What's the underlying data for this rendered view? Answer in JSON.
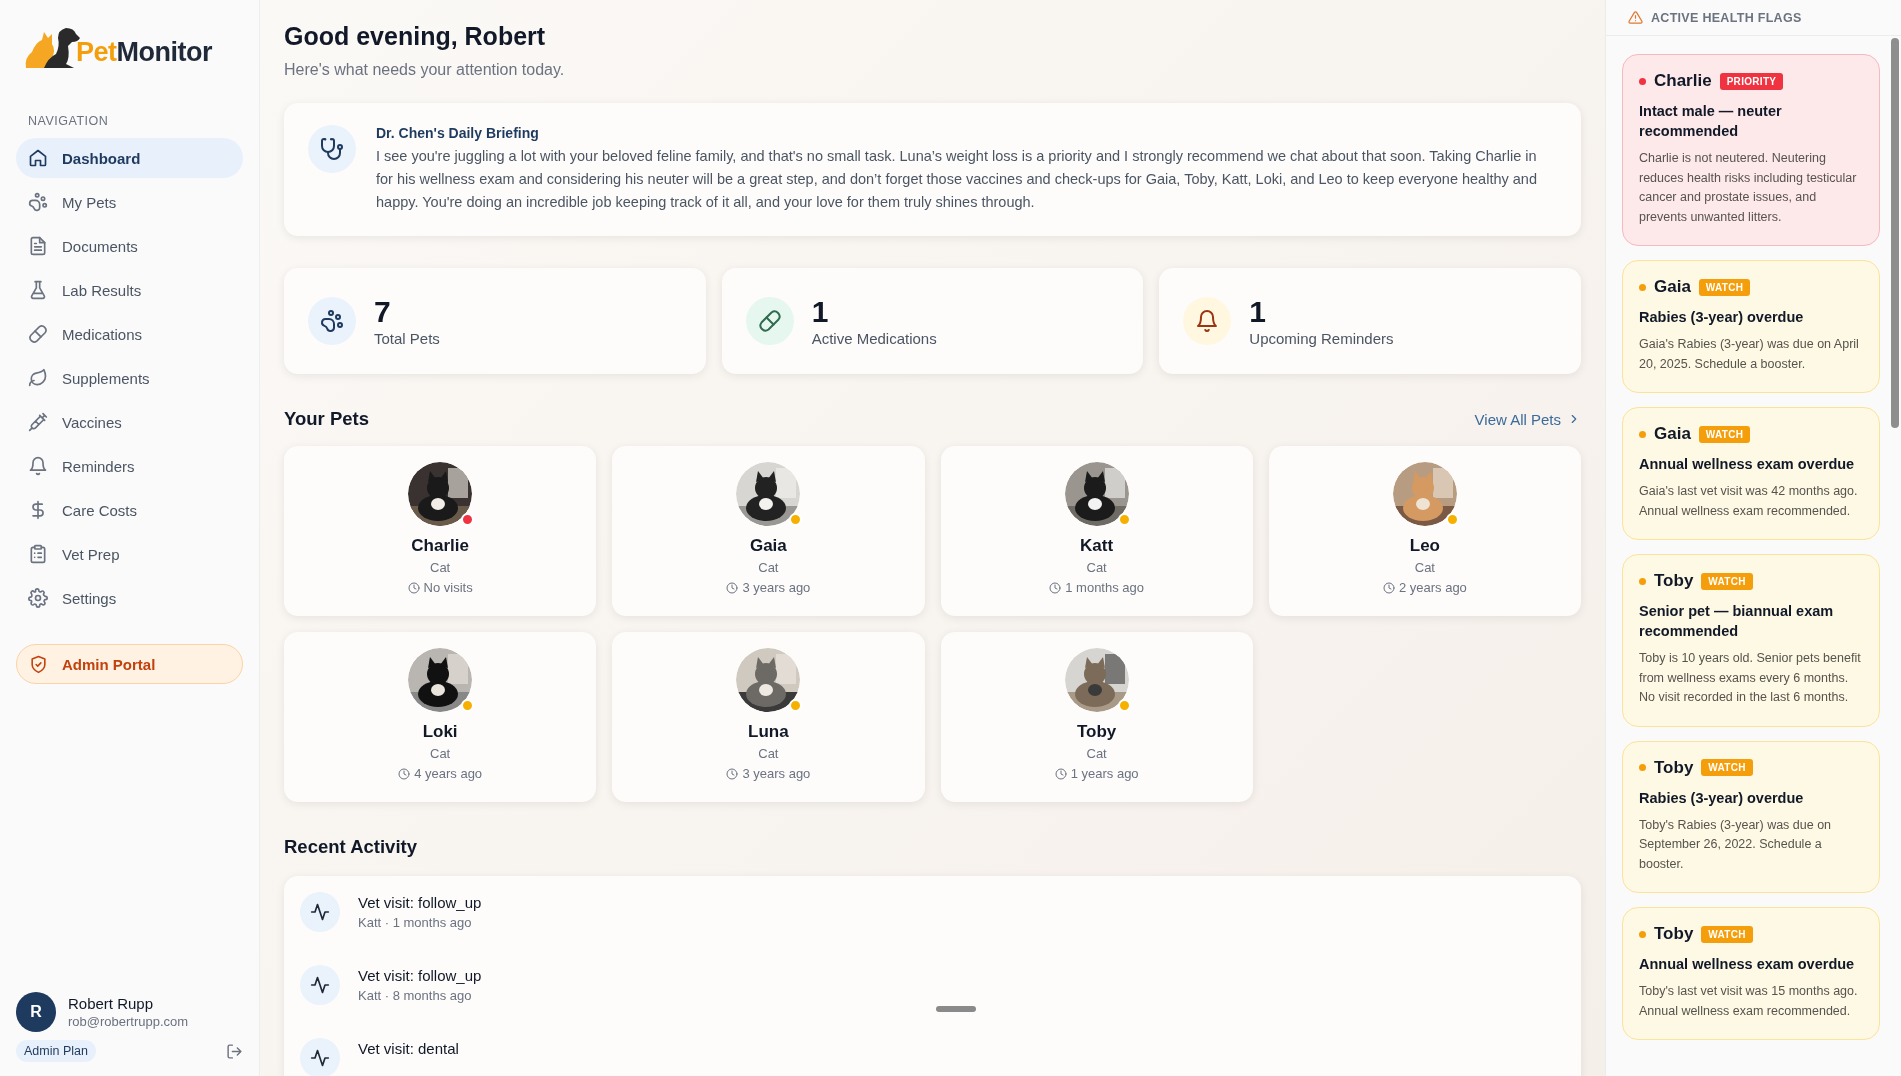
{
  "sidebar": {
    "logo": {
      "text_1": "Pet",
      "text_2": "Monitor"
    },
    "section_label": "NAVIGATION",
    "items": [
      {
        "label": "Dashboard",
        "selected": true
      },
      {
        "label": "My Pets",
        "selected": false
      },
      {
        "label": "Documents",
        "selected": false
      },
      {
        "label": "Lab Results",
        "selected": false
      },
      {
        "label": "Medications",
        "selected": false
      },
      {
        "label": "Supplements",
        "selected": false
      },
      {
        "label": "Vaccines",
        "selected": false
      },
      {
        "label": "Reminders",
        "selected": false
      },
      {
        "label": "Care Costs",
        "selected": false
      },
      {
        "label": "Vet Prep",
        "selected": false
      },
      {
        "label": "Settings",
        "selected": false
      }
    ],
    "admin_button": "Admin Portal",
    "user": {
      "initial": "R",
      "name": "Robert Rupp",
      "email": "rob@robertrupp.com",
      "plan": "Admin Plan"
    }
  },
  "header": {
    "title": "Good evening, Robert",
    "subtitle": "Here's what needs your attention today."
  },
  "briefing": {
    "title": "Dr. Chen's Daily Briefing",
    "text": "I see you're juggling a lot with your beloved feline family, and that's no small task. Luna’s weight loss is a priority and I strongly recommend we chat about that soon. Taking Charlie in for his wellness exam and considering his neuter will be a great step, and don’t forget those vaccines and check-ups for Gaia, Toby, Katt, Loki, and Leo to keep everyone healthy and happy. You're doing an incredible job keeping track of it all, and your love for them truly shines through."
  },
  "stats": [
    {
      "value": "7",
      "label": "Total Pets"
    },
    {
      "value": "1",
      "label": "Active Medications"
    },
    {
      "value": "1",
      "label": "Upcoming Reminders"
    }
  ],
  "pets_section": {
    "title": "Your Pets",
    "link": "View All Pets",
    "pets": [
      {
        "name": "Charlie",
        "species": "Cat",
        "last_visit": "No visits",
        "color": "#ef3340"
      },
      {
        "name": "Gaia",
        "species": "Cat",
        "last_visit": "3 years ago",
        "color": "#f5b000"
      },
      {
        "name": "Katt",
        "species": "Cat",
        "last_visit": "1 months ago",
        "color": "#f5b000"
      },
      {
        "name": "Leo",
        "species": "Cat",
        "last_visit": "2 years ago",
        "color": "#f5b000"
      },
      {
        "name": "Loki",
        "species": "Cat",
        "last_visit": "4 years ago",
        "color": "#f5b000"
      },
      {
        "name": "Luna",
        "species": "Cat",
        "last_visit": "3 years ago",
        "color": "#f5b000"
      },
      {
        "name": "Toby",
        "species": "Cat",
        "last_visit": "1 years ago",
        "color": "#f5b000"
      }
    ]
  },
  "activity": {
    "title": "Recent Activity",
    "items": [
      {
        "title": "Vet visit: follow_up",
        "meta": "Katt · 1 months ago"
      },
      {
        "title": "Vet visit: follow_up",
        "meta": "Katt · 8 months ago"
      },
      {
        "title": "Vet visit: dental"
      }
    ]
  },
  "health_flags": {
    "title": "ACTIVE HEALTH FLAGS",
    "flags": [
      {
        "kind": "priority",
        "pet": "Charlie",
        "badge": "PRIORITY",
        "title": "Intact male — neuter recommended",
        "text": "Charlie is not neutered. Neutering reduces health risks including testicular cancer and prostate issues, and prevents unwanted litters."
      },
      {
        "kind": "watch",
        "pet": "Gaia",
        "badge": "WATCH",
        "title": "Rabies (3-year) overdue",
        "text": "Gaia's Rabies (3-year) was due on April 20, 2025. Schedule a booster."
      },
      {
        "kind": "watch",
        "pet": "Gaia",
        "badge": "WATCH",
        "title": "Annual wellness exam overdue",
        "text": "Gaia's last vet visit was 42 months ago. Annual wellness exam recommended."
      },
      {
        "kind": "watch",
        "pet": "Toby",
        "badge": "WATCH",
        "title": "Senior pet — biannual exam recommended",
        "text": "Toby is 10 years old. Senior pets benefit from wellness exams every 6 months. No visit recorded in the last 6 months."
      },
      {
        "kind": "watch",
        "pet": "Toby",
        "badge": "WATCH",
        "title": "Rabies (3-year) overdue",
        "text": "Toby's Rabies (3-year) was due on September 26, 2022. Schedule a booster."
      },
      {
        "kind": "watch",
        "pet": "Toby",
        "badge": "WATCH",
        "title": "Annual wellness exam overdue",
        "text": "Toby's last vet visit was 15 months ago. Annual wellness exam recommended."
      }
    ]
  }
}
